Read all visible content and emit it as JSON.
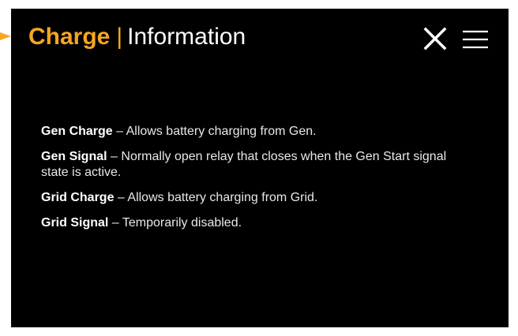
{
  "header": {
    "title_accent": "Charge",
    "separator": "|",
    "title_rest": "Information"
  },
  "icons": {
    "close": "close-icon",
    "menu": "hamburger-menu-icon",
    "pointer": "triangle-arrow-icon"
  },
  "colors": {
    "accent": "#f5a623",
    "background": "#000000",
    "text": "#ffffff"
  },
  "entries": [
    {
      "term": "Gen Charge",
      "dash": "–",
      "desc": "Allows battery charging from Gen."
    },
    {
      "term": "Gen Signal",
      "dash": "–",
      "desc": "Normally open relay that closes when the Gen Start signal state is active."
    },
    {
      "term": "Grid Charge",
      "dash": "–",
      "desc": "Allows battery charging from Grid."
    },
    {
      "term": "Grid Signal",
      "dash": "–",
      "desc": "Temporarily disabled."
    }
  ]
}
